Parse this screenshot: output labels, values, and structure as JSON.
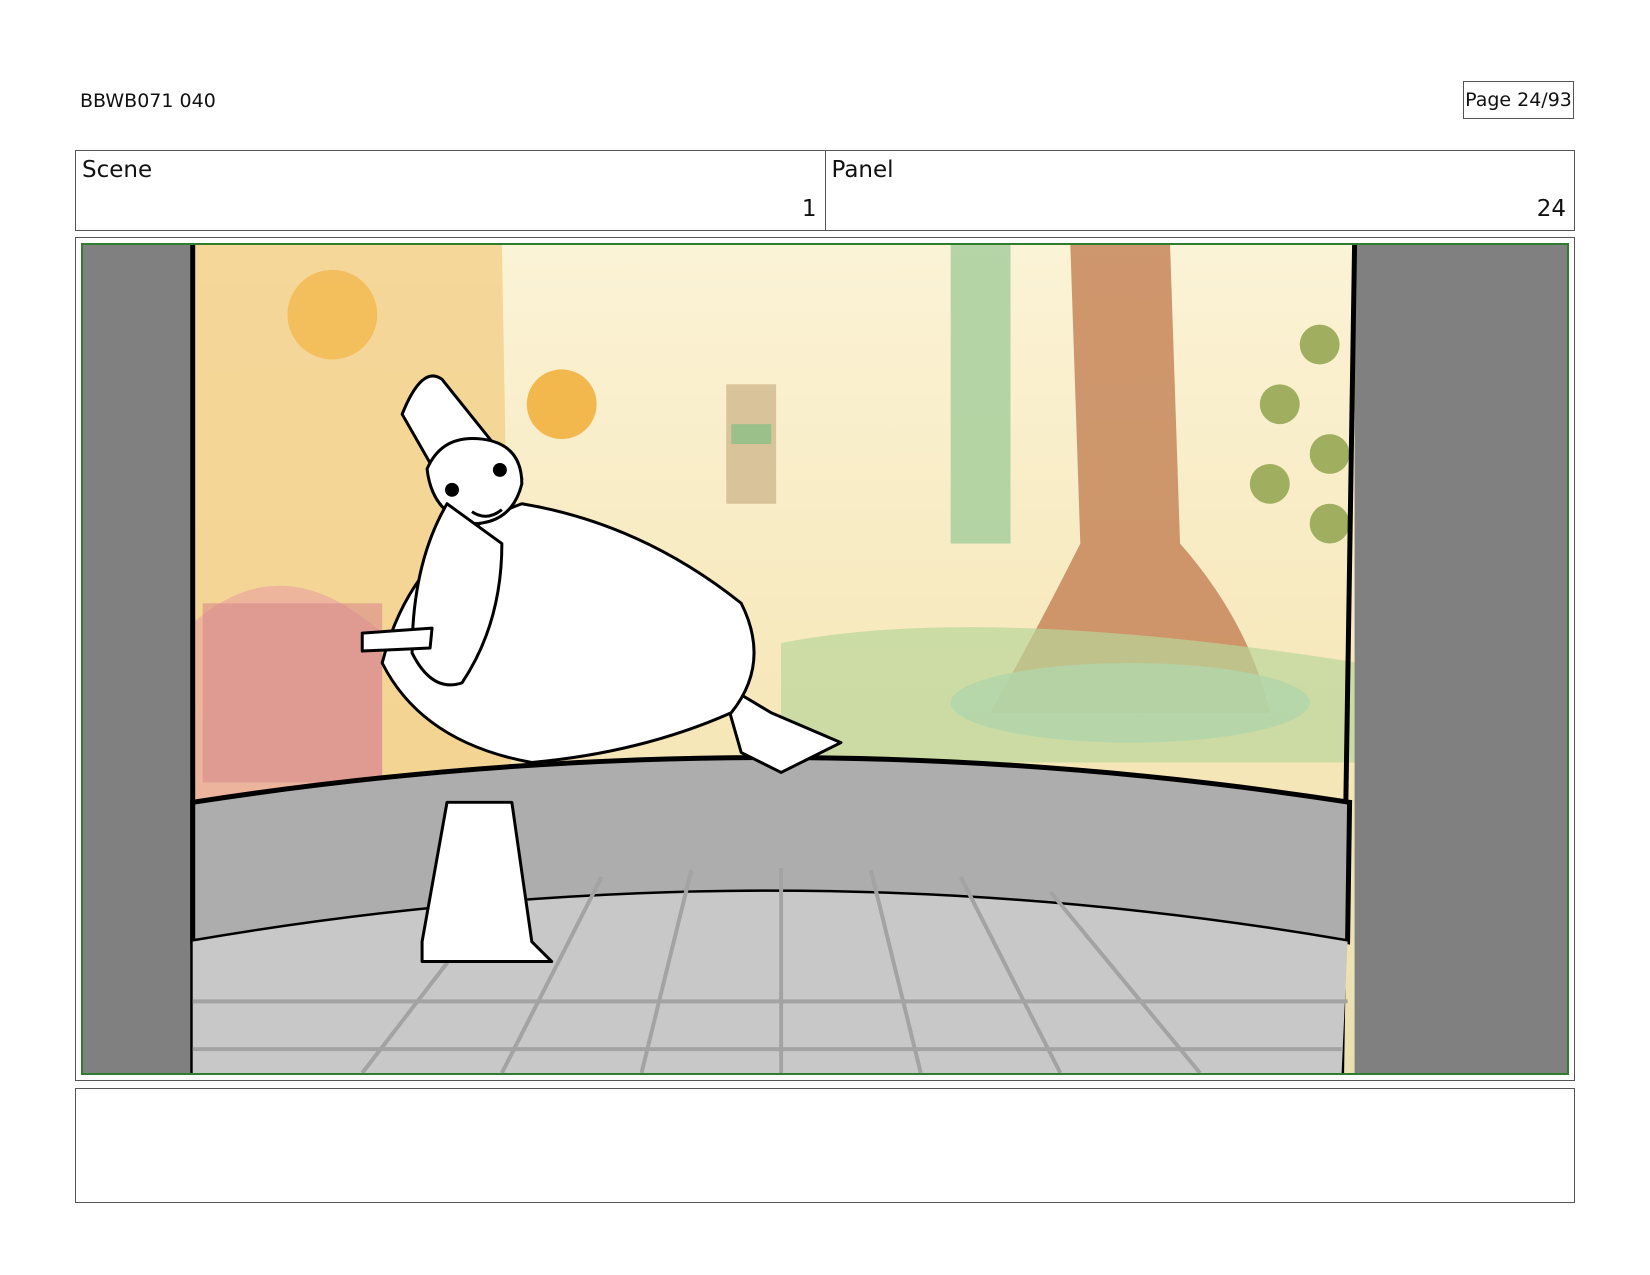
{
  "header": {
    "doc_id": "BBWB071 040",
    "page_label": "Page 24/93"
  },
  "info": {
    "scene_label": "Scene",
    "scene_value": "1",
    "panel_label": "Panel",
    "panel_value": "24"
  },
  "panel_image": {
    "description_icon": "storyboard-sketch",
    "frame_color": "#2f7d2f",
    "curtain_color": "#808080",
    "floor_color": "#c8c8c8"
  },
  "notes": {
    "text": ""
  }
}
